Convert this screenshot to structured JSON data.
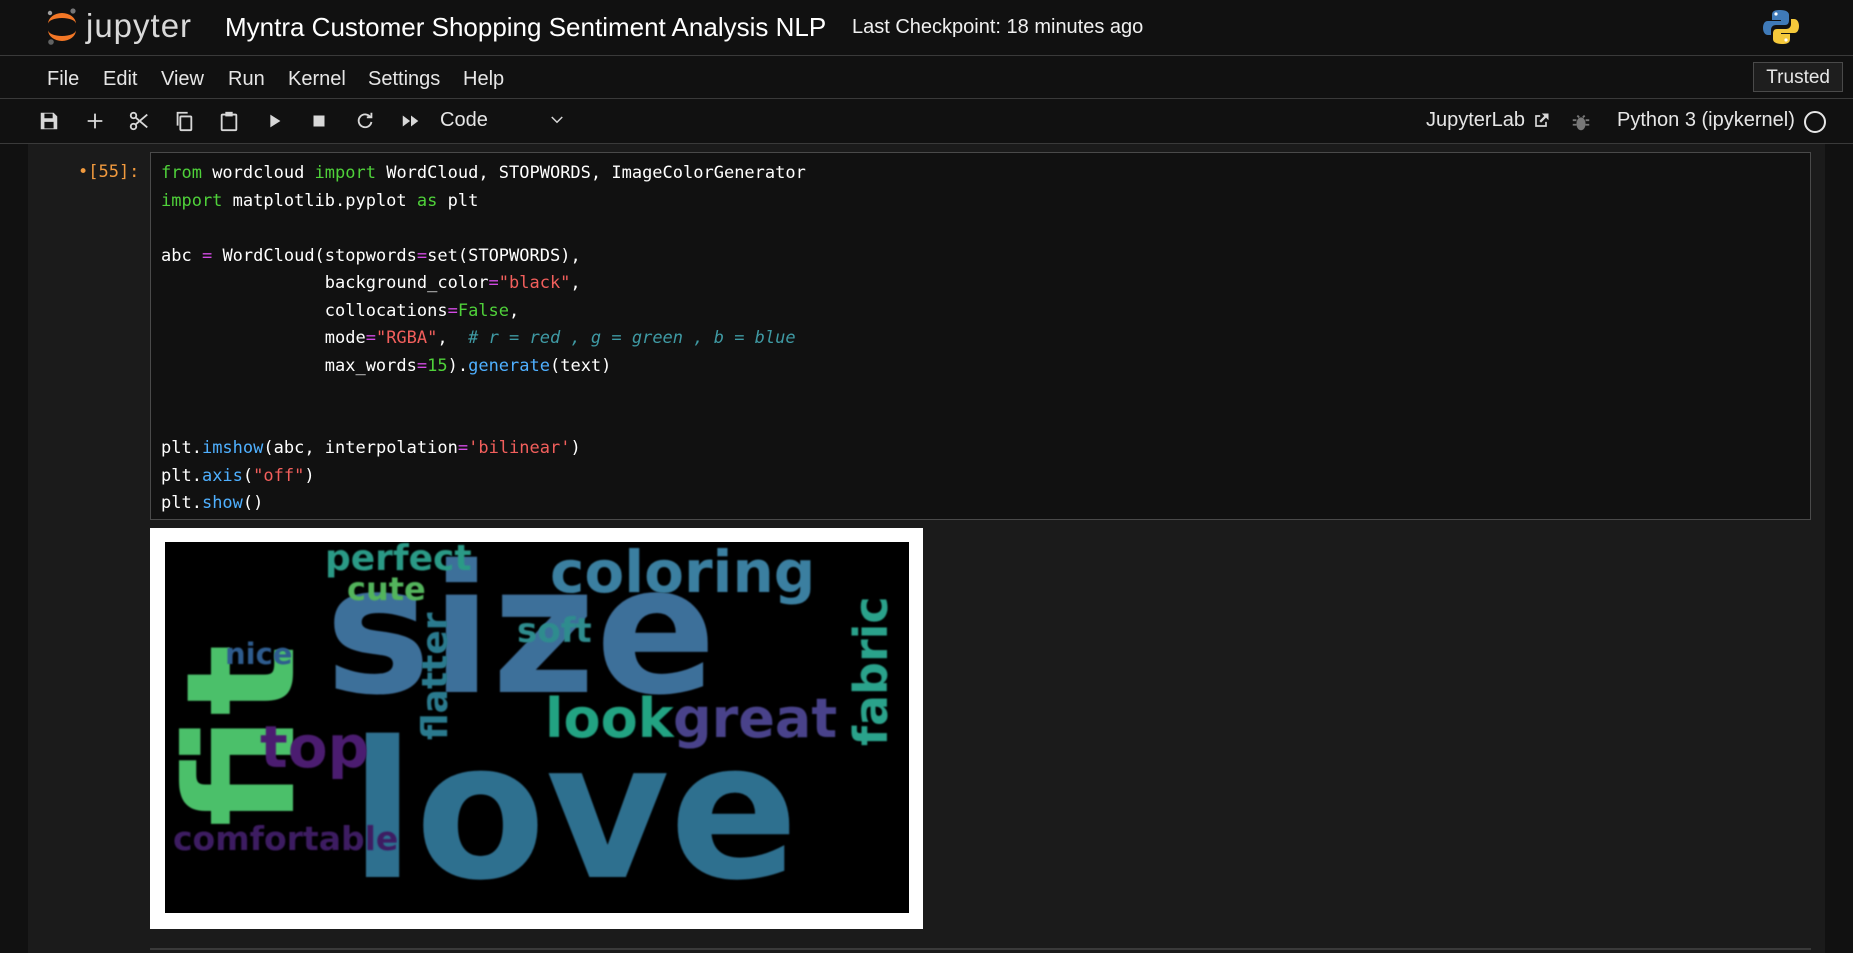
{
  "header": {
    "logo_text": "jupyter",
    "notebook_title": "Myntra Customer Shopping Sentiment Analysis NLP",
    "checkpoint": "Last Checkpoint: 18 minutes ago"
  },
  "menu": {
    "items": [
      "File",
      "Edit",
      "View",
      "Run",
      "Kernel",
      "Settings",
      "Help"
    ],
    "trusted": "Trusted"
  },
  "toolbar": {
    "buttons": [
      "save-icon",
      "add-cell-icon",
      "cut-icon",
      "copy-icon",
      "paste-icon",
      "run-icon",
      "stop-icon",
      "restart-icon",
      "fast-forward-icon"
    ],
    "cell_type": "Code",
    "jupyterlab_link": "JupyterLab",
    "kernel": "Python 3 (ipykernel)"
  },
  "cell": {
    "prompt": "•[55]:",
    "code_lines": [
      "from wordcloud import WordCloud, STOPWORDS, ImageColorGenerator",
      "import matplotlib.pyplot as plt",
      "",
      "abc = WordCloud(stopwords=set(STOPWORDS),",
      "                background_color=\"black\",",
      "                collocations=False,",
      "                mode=\"RGBA\",  # r = red , g = green , b = blue",
      "                max_words=15).generate(text)",
      "",
      "",
      "plt.imshow(abc, interpolation='bilinear')",
      "plt.axis(\"off\")",
      "plt.show()"
    ]
  },
  "output": {
    "wordcloud_words": [
      {
        "text": "size",
        "color": "#3e6f9a"
      },
      {
        "text": "love",
        "color": "#2e6f8f"
      },
      {
        "text": "fit",
        "color": "#4cc06a"
      },
      {
        "text": "coloring",
        "color": "#3a7fa0"
      },
      {
        "text": "perfect",
        "color": "#2a9a86"
      },
      {
        "text": "fabric",
        "color": "#2aa28b"
      },
      {
        "text": "cute",
        "color": "#52b45c"
      },
      {
        "text": "soft",
        "color": "#2e8c8e"
      },
      {
        "text": "flatter",
        "color": "#2c7a8e"
      },
      {
        "text": "nice",
        "color": "#2e5c8e"
      },
      {
        "text": "look",
        "color": "#22a382"
      },
      {
        "text": "great",
        "color": "#48438a"
      },
      {
        "text": "top",
        "color": "#4b1c70"
      },
      {
        "text": "comfortable",
        "color": "#3c1a62"
      }
    ]
  },
  "colors": {
    "background": "#111111",
    "prompt": "#f19a3e",
    "keyword": "#4fd13a",
    "operator": "#d34be4",
    "string": "#f25f5c",
    "function": "#4fb0ff",
    "comment": "#3f9aa4"
  }
}
